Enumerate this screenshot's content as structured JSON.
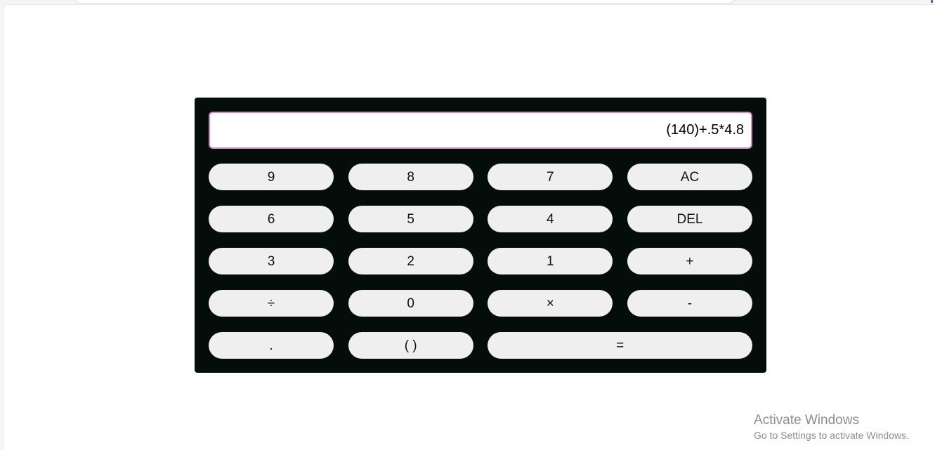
{
  "calculator": {
    "display": "(140)+.5*4.8",
    "keys": [
      "9",
      "8",
      "7",
      "AC",
      "6",
      "5",
      "4",
      "DEL",
      "3",
      "2",
      "1",
      "+",
      "÷",
      "0",
      "×",
      "-",
      ".",
      "( )",
      "="
    ]
  },
  "watermark": {
    "title": "Activate Windows",
    "subtitle": "Go to Settings to activate Windows."
  }
}
